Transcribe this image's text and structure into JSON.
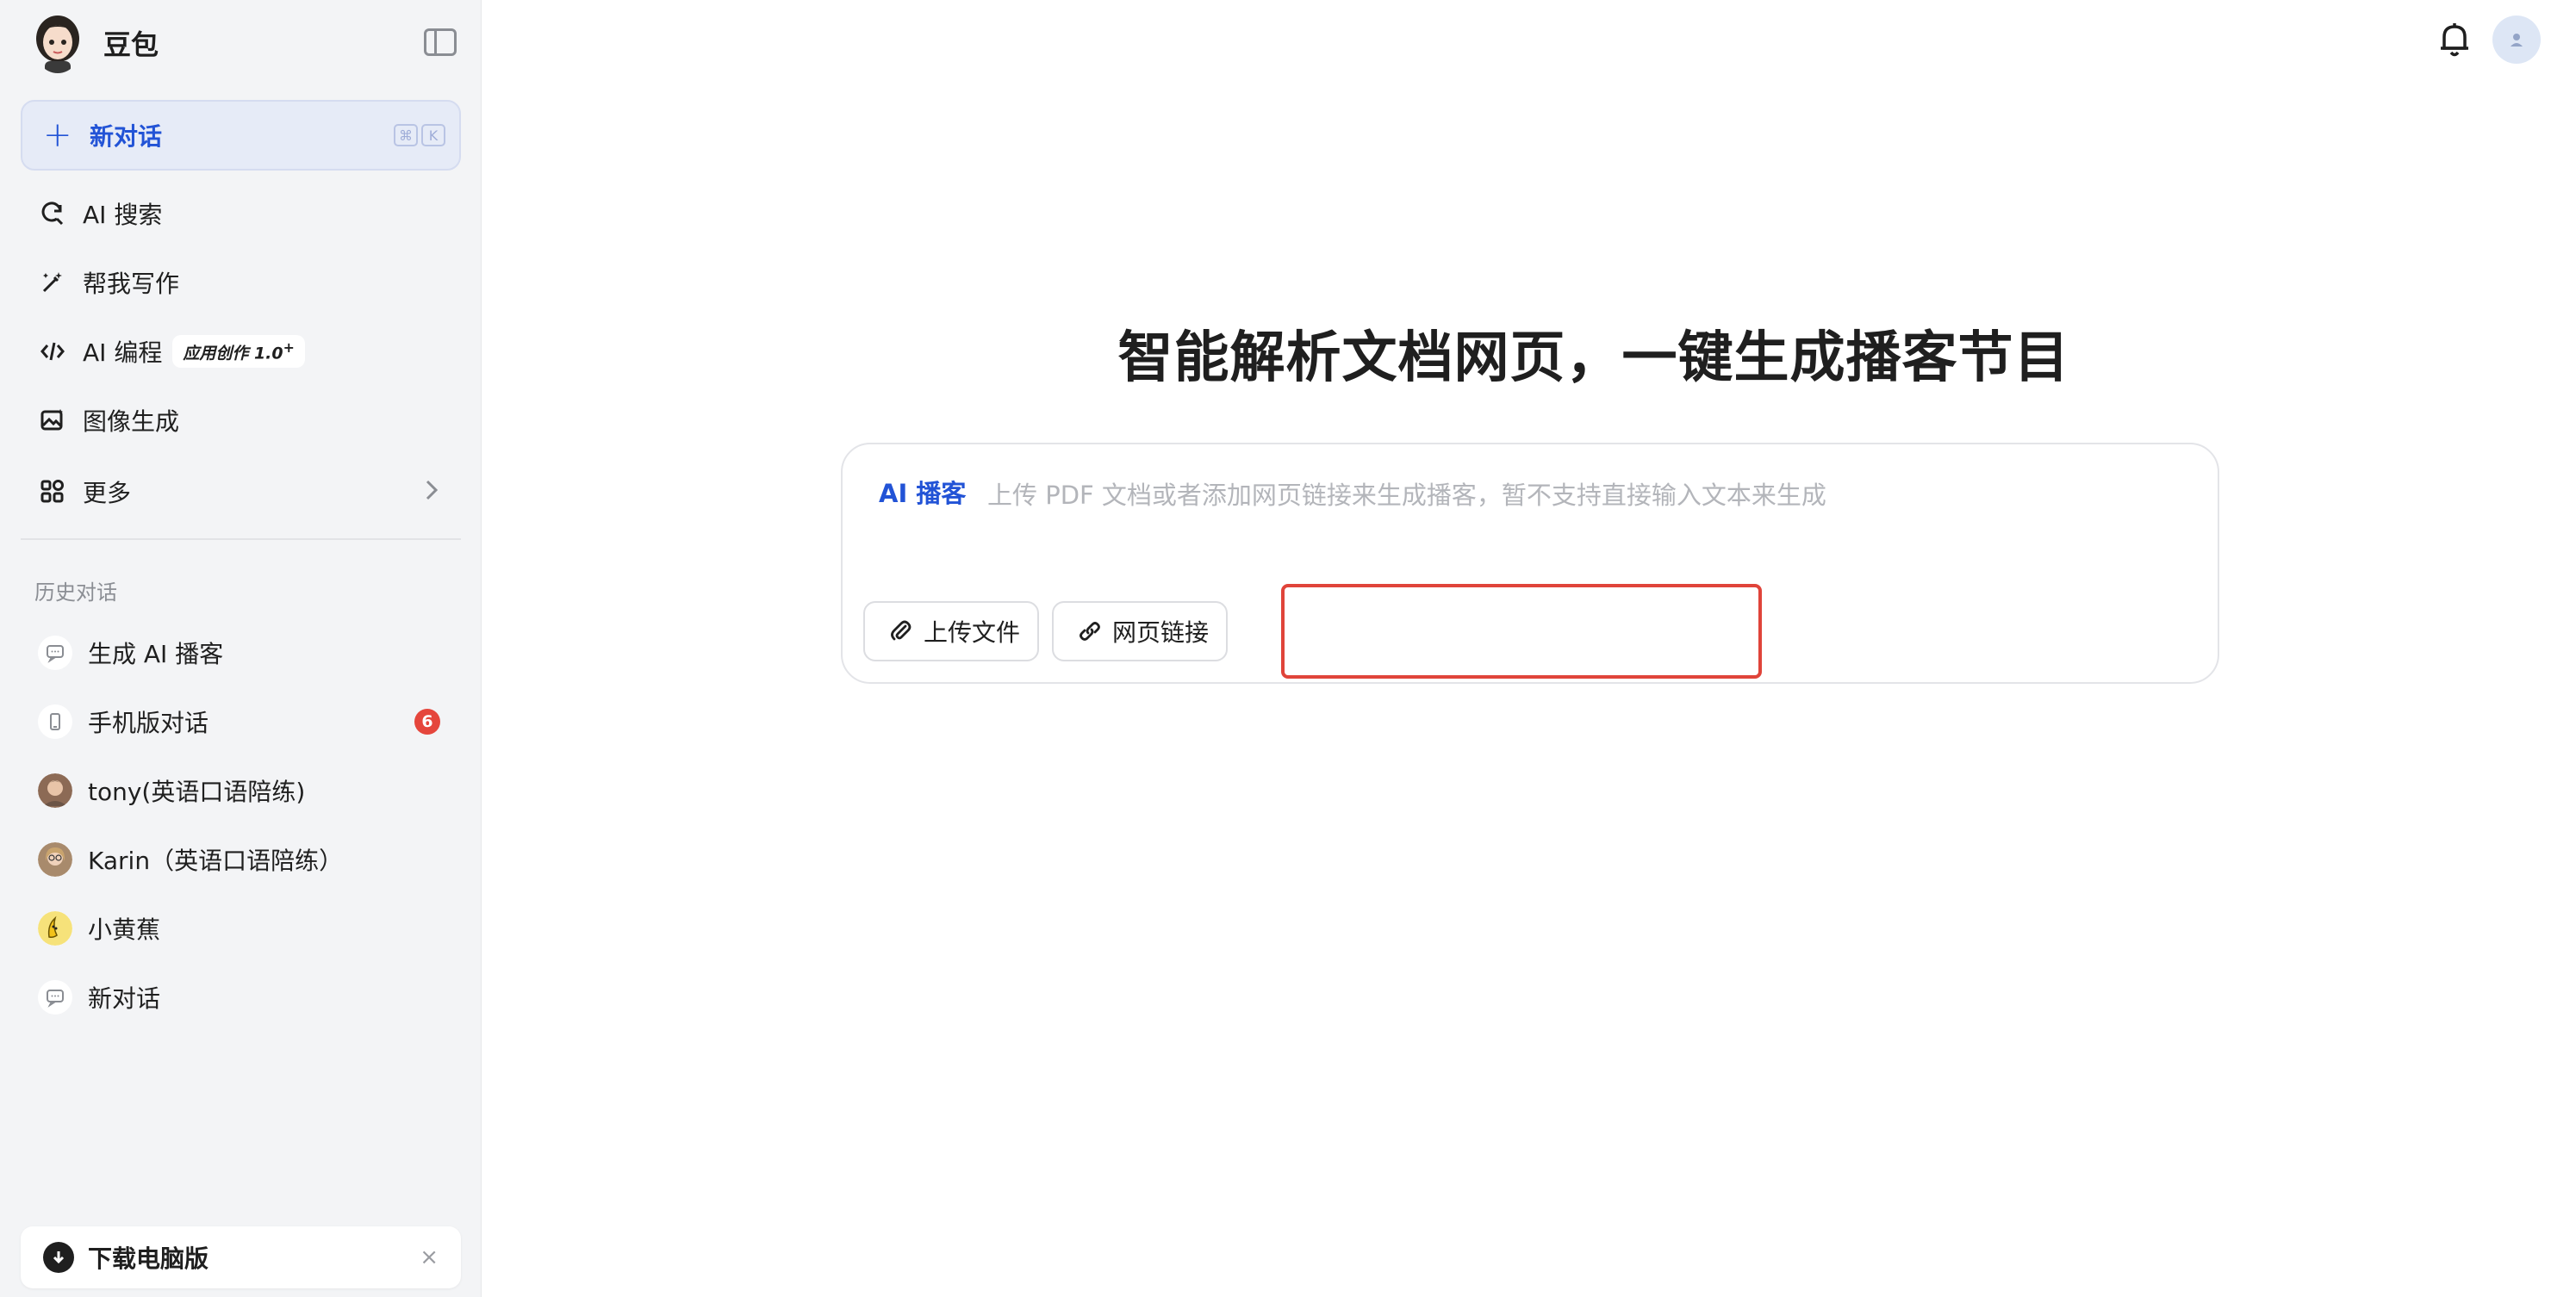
{
  "brand": {
    "name": "豆包"
  },
  "sidebar": {
    "new_chat": {
      "label": "新对话",
      "shortcut": [
        "⌘",
        "K"
      ]
    },
    "nav": [
      {
        "label": "AI 搜索",
        "icon": "search-refresh-icon"
      },
      {
        "label": "帮我写作",
        "icon": "pen-sparkle-icon"
      },
      {
        "label": "AI 编程",
        "icon": "code-icon",
        "badge": "应用创作 1.0",
        "badge_sup": "+"
      },
      {
        "label": "图像生成",
        "icon": "image-icon"
      },
      {
        "label": "更多",
        "icon": "apps-icon"
      }
    ],
    "history_title": "历史对话",
    "history": [
      {
        "label": "生成 AI 播客",
        "icon": "chat-icon"
      },
      {
        "label": "手机版对话",
        "icon": "phone-icon",
        "count": "6"
      },
      {
        "label": "tony(英语口语陪练)",
        "icon": "avatar-tony"
      },
      {
        "label": "Karin（英语口语陪练）",
        "icon": "avatar-karin"
      },
      {
        "label": "小黄蕉",
        "icon": "avatar-banana"
      },
      {
        "label": "新对话",
        "icon": "chat-icon"
      }
    ],
    "download": {
      "label": "下载电脑版",
      "close": "×"
    }
  },
  "main": {
    "headline": "智能解析文档网页，一键生成播客节目",
    "composer": {
      "tag": "AI 播客",
      "placeholder": "上传 PDF 文档或者添加网页链接来生成播客，暂不支持直接输入文本来生成",
      "upload_label": "上传文件",
      "link_label": "网页链接"
    }
  },
  "colors": {
    "accent": "#2253d6",
    "highlight_border": "#e0443a",
    "badge_red": "#e5463c",
    "sidebar_bg": "#f3f4f6"
  }
}
